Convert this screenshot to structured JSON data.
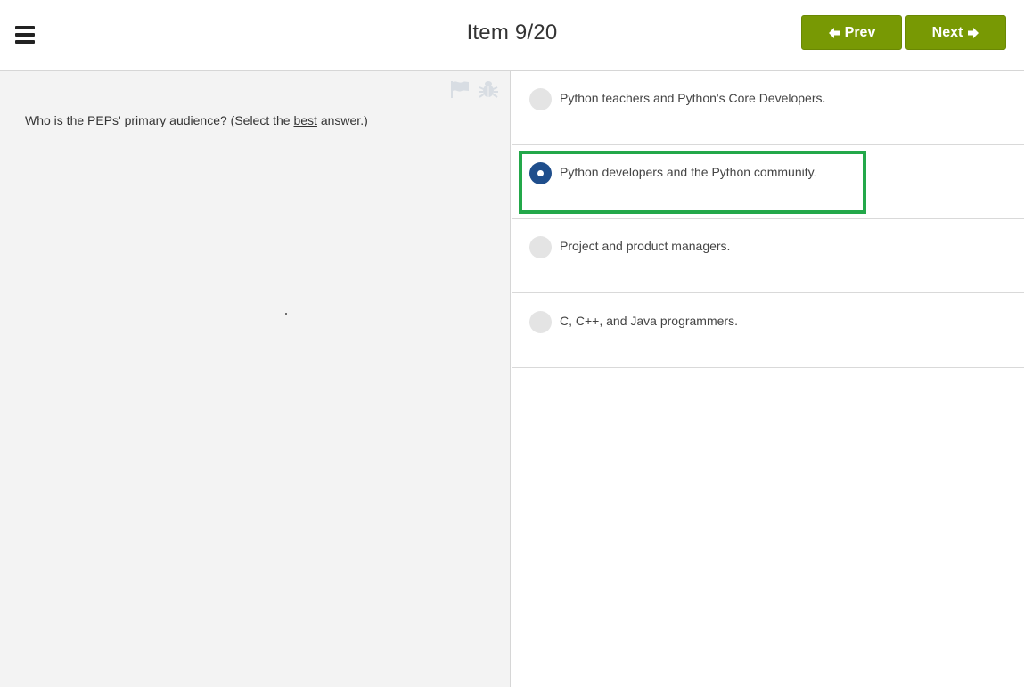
{
  "header": {
    "title": "Item 9/20",
    "prev_label": "Prev",
    "next_label": "Next",
    "button_color": "#789904"
  },
  "question": {
    "text_before": "Who is the PEPs' primary audience? (Select the ",
    "emphasis": "best",
    "text_after": " answer.)"
  },
  "options": [
    {
      "label": "Python teachers and Python's Core Developers.",
      "selected": false
    },
    {
      "label": "Python developers and the Python community.",
      "selected": true
    },
    {
      "label": "Project and product managers.",
      "selected": false
    },
    {
      "label": "C, C++, and Java programmers.",
      "selected": false
    }
  ],
  "icons": [
    "menu-icon",
    "arrow-left-icon",
    "arrow-right-icon",
    "flag-icon",
    "bug-icon"
  ],
  "colors": {
    "radio_selected": "#1f4e8c",
    "highlight": "#23a84a"
  }
}
